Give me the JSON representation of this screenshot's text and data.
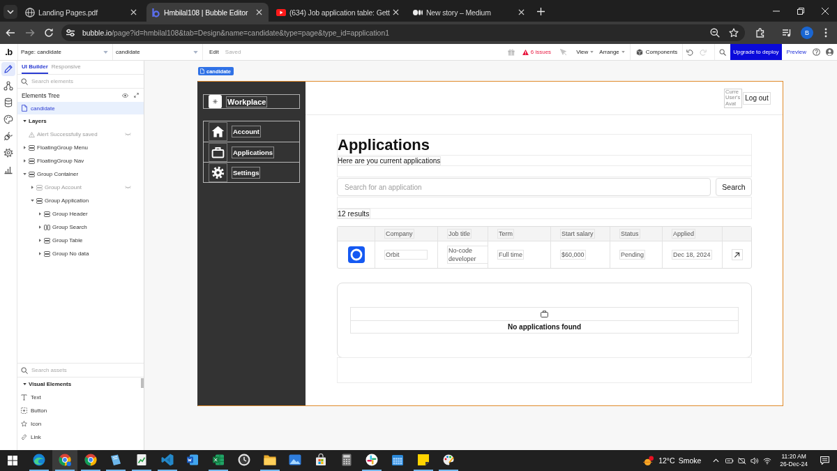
{
  "browser": {
    "tabs": [
      {
        "title": "Landing Pages.pdf",
        "kind": "globe",
        "selected": false
      },
      {
        "title": "Hmbilal108 | Bubble Editor",
        "kind": "bubble",
        "selected": true
      },
      {
        "title": "(634) Job application table: Gett",
        "kind": "video",
        "selected": false
      },
      {
        "title": "New story – Medium",
        "kind": "medium",
        "selected": false
      }
    ],
    "address": {
      "host": "bubble.io",
      "path": "/page?id=hmbilal108&tab=Design&name=candidate&type=page&type_id=application1"
    },
    "profile": "B"
  },
  "editor": {
    "logo": ".b",
    "page_select": "Page: candidate",
    "element_select": "candidate",
    "edit": "Edit",
    "status": "Saved",
    "issues": "6 issues",
    "menus": [
      "View",
      "Arrange"
    ],
    "components": "Components",
    "deploy": "Upgrade to deploy",
    "preview": "Preview"
  },
  "rail": [
    {
      "kind": "pencil",
      "selected": true
    },
    {
      "kind": "workflow",
      "selected": false
    },
    {
      "kind": "data",
      "selected": false
    },
    {
      "kind": "styles",
      "selected": false
    },
    {
      "kind": "plugins",
      "selected": false
    },
    {
      "kind": "settings",
      "selected": false
    },
    {
      "kind": "logs",
      "selected": false
    }
  ],
  "panel": {
    "tabs": [
      {
        "label": "UI Builder",
        "selected": true
      },
      {
        "label": "Responsive",
        "selected": false
      }
    ],
    "search": {
      "placeholder": "Search elements"
    },
    "tree_title": "Elements Tree",
    "page": {
      "label": "candidate",
      "selected": true
    },
    "layers": {
      "label": "Layers",
      "expanded": true,
      "children": [
        {
          "label": "Alert Successfully saved",
          "kind": "alert",
          "hidden": true
        },
        {
          "label": "FloatingGroup Menu",
          "kind": "rows",
          "hidden": false,
          "expanded": false
        },
        {
          "label": "FloatingGroup Nav",
          "kind": "rows",
          "hidden": false,
          "expanded": false
        },
        {
          "label": "Group Container",
          "kind": "rows",
          "hidden": false,
          "expanded": true,
          "children": [
            {
              "label": "Group Account",
              "kind": "rows",
              "hidden": true,
              "expanded": false
            },
            {
              "label": "Group Application",
              "kind": "rows",
              "hidden": false,
              "expanded": true,
              "children": [
                {
                  "label": "Group Header",
                  "kind": "rows",
                  "hidden": false,
                  "expanded": false
                },
                {
                  "label": "Group Search",
                  "kind": "columns",
                  "hidden": false,
                  "expanded": false
                },
                {
                  "label": "Group Table",
                  "kind": "rows",
                  "hidden": false,
                  "expanded": false
                },
                {
                  "label": "Group No data",
                  "kind": "rows",
                  "hidden": false,
                  "expanded": false
                }
              ]
            }
          ]
        }
      ]
    },
    "assets": {
      "search": {
        "placeholder": "Search assets"
      },
      "section": {
        "label": "Visual Elements",
        "expanded": true
      },
      "items": [
        {
          "label": "Text",
          "kind": "text"
        },
        {
          "label": "Button",
          "kind": "button"
        },
        {
          "label": "Icon",
          "kind": "icon"
        },
        {
          "label": "Link",
          "kind": "link"
        }
      ]
    }
  },
  "canvas": {
    "page_label": "candidate",
    "brand": "Workplace",
    "nav": [
      {
        "label": "Account",
        "kind": "home"
      },
      {
        "label": "Applications",
        "kind": "briefcase"
      },
      {
        "label": "Settings",
        "kind": "gear"
      }
    ],
    "avatar_alt": "Curre User's Avat",
    "logout": "Log out",
    "title": "Applications",
    "subtitle": "Here are you current applications",
    "search": {
      "placeholder": "Search for an application",
      "button": "Search"
    },
    "count": "12 results",
    "table": {
      "columns": [
        "Company",
        "Job title",
        "Term",
        "Start salary",
        "Status",
        "Applied"
      ],
      "rows": [
        {
          "cells": [
            "Orbit",
            "No-code developer",
            "Full time",
            "$60,000",
            "Pending",
            "Dec 18, 2024"
          ]
        }
      ]
    },
    "empty_message": "No applications found"
  },
  "taskbar": {
    "apps": [
      {
        "kind": "edge",
        "selected": false,
        "running": true
      },
      {
        "kind": "chrome-profile",
        "selected": true,
        "running": true
      },
      {
        "kind": "chrome",
        "selected": false,
        "running": true
      },
      {
        "kind": "notebook",
        "selected": false,
        "running": true
      },
      {
        "kind": "chart-doc",
        "selected": false,
        "running": true
      },
      {
        "kind": "code",
        "selected": false,
        "running": true
      },
      {
        "kind": "word",
        "selected": false,
        "running": false
      },
      {
        "kind": "sheet",
        "selected": false,
        "running": true
      },
      {
        "kind": "clock",
        "selected": false,
        "running": false
      },
      {
        "kind": "folder",
        "selected": false,
        "running": true
      },
      {
        "kind": "photos",
        "selected": false,
        "running": false
      },
      {
        "kind": "store",
        "selected": false,
        "running": false
      },
      {
        "kind": "calculator",
        "selected": false,
        "running": false
      },
      {
        "kind": "chat",
        "selected": false,
        "running": true
      },
      {
        "kind": "calendar",
        "selected": false,
        "running": false
      },
      {
        "kind": "sticky",
        "selected": false,
        "running": true
      },
      {
        "kind": "paint",
        "selected": false,
        "running": true
      }
    ],
    "weather": {
      "temperature": "12°C",
      "condition": "Smoke"
    },
    "clock": {
      "time": "11:20 AM",
      "date": "26-Dec-24"
    }
  }
}
